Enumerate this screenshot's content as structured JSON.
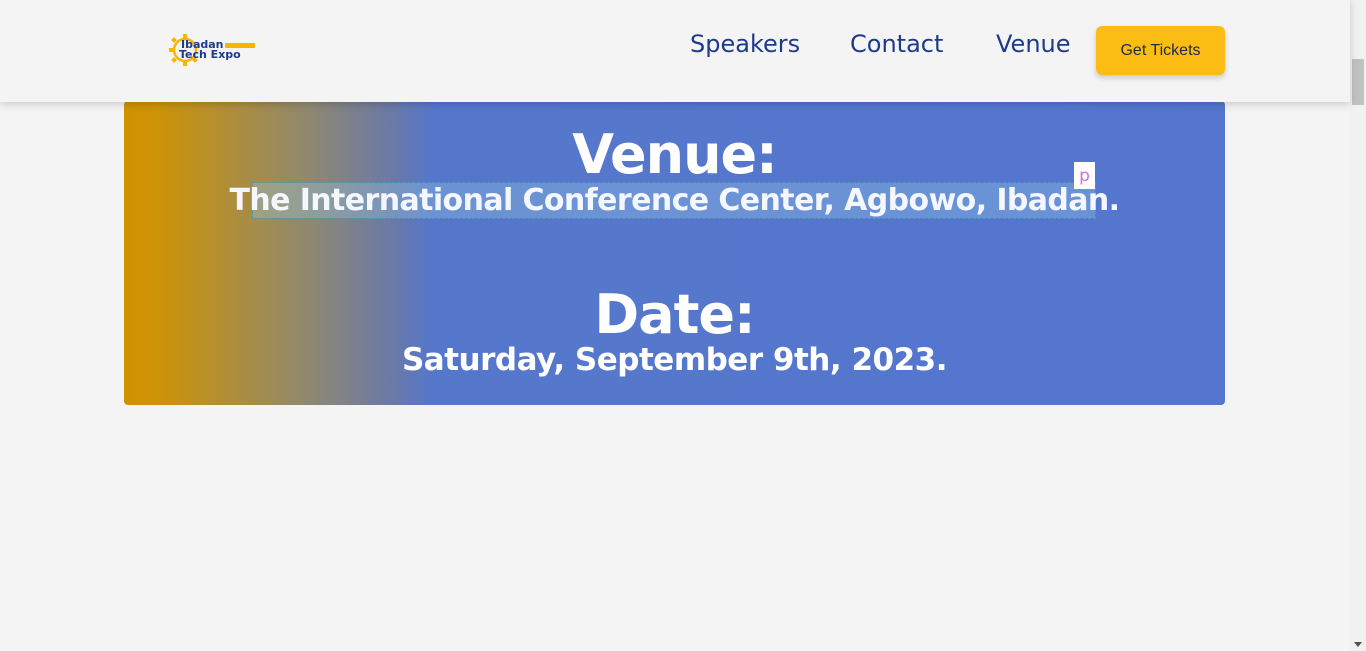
{
  "header": {
    "logo": {
      "line1": "Ibadan",
      "line2": "Tech Expo",
      "icon": "gear-logo-icon",
      "colors": {
        "gear": "#f7b400",
        "text": "#1e3a8a",
        "bar": "#f7b400"
      }
    },
    "nav": [
      {
        "label": "Speakers"
      },
      {
        "label": "Contact"
      },
      {
        "label": "Venue"
      }
    ],
    "cta_label": "Get Tickets"
  },
  "hero": {
    "venue_heading": "Venue:",
    "venue_text": "The International Conference Center, Agbowo, Ibadan.",
    "date_heading": "Date:",
    "date_text": "Saturday, September 9th, 2023.",
    "inspector_badge": "p"
  },
  "colors": {
    "accent": "#fbbd14",
    "nav_text": "#1e3a8a",
    "hero_blue": "#5476cf",
    "hero_gold": "#cf9100"
  }
}
